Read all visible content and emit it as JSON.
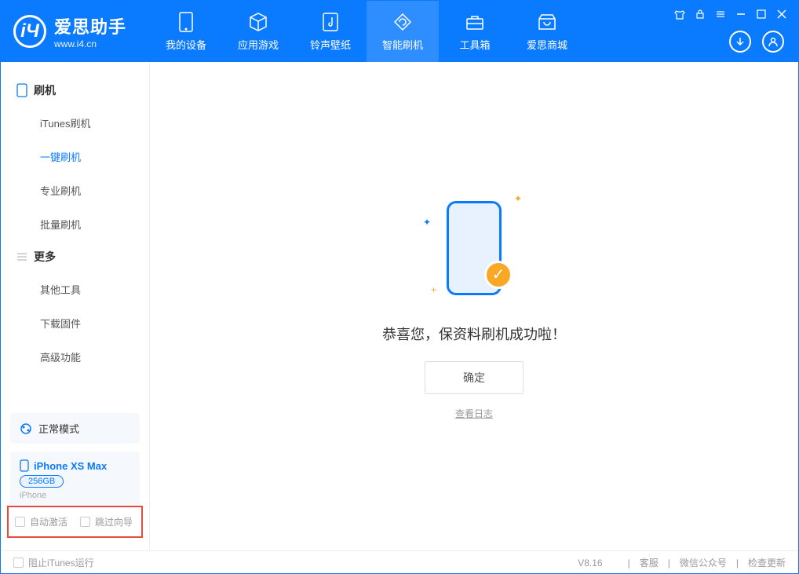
{
  "app": {
    "title": "爱思助手",
    "subtitle": "www.i4.cn"
  },
  "header": {
    "tabs": [
      {
        "label": "我的设备",
        "icon": "device"
      },
      {
        "label": "应用游戏",
        "icon": "cube"
      },
      {
        "label": "铃声壁纸",
        "icon": "music"
      },
      {
        "label": "智能刷机",
        "icon": "refresh"
      },
      {
        "label": "工具箱",
        "icon": "tools"
      },
      {
        "label": "爱思商城",
        "icon": "shop"
      }
    ]
  },
  "sidebar": {
    "section1": "刷机",
    "items1": [
      "iTunes刷机",
      "一键刷机",
      "专业刷机",
      "批量刷机"
    ],
    "section2": "更多",
    "items2": [
      "其他工具",
      "下载固件",
      "高级功能"
    ],
    "mode": "正常模式",
    "device": {
      "name": "iPhone XS Max",
      "capacity": "256GB",
      "type": "iPhone"
    },
    "checkboxes": [
      "自动激活",
      "跳过向导"
    ]
  },
  "main": {
    "success_text": "恭喜您，保资料刷机成功啦！",
    "ok_button": "确定",
    "log_link": "查看日志"
  },
  "footer": {
    "block_itunes": "阻止iTunes运行",
    "version": "V8.16",
    "links": [
      "客服",
      "微信公众号",
      "检查更新"
    ]
  }
}
